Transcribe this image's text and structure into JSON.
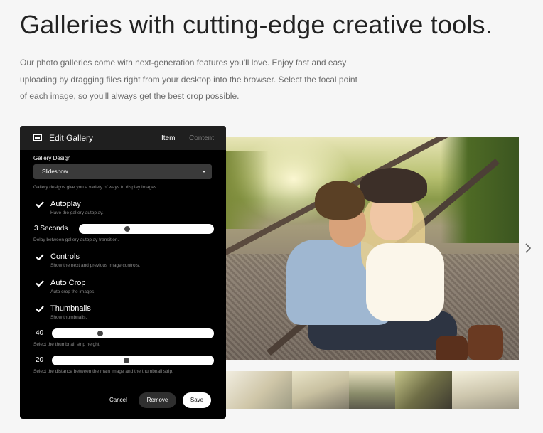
{
  "headline": "Galleries with cutting-edge creative tools.",
  "intro": "Our photo galleries come with next-generation features you'll love. Enjoy fast and easy uploading by dragging files right from your desktop into the browser. Select the focal point of each image, so you'll always get the best crop possible.",
  "panel": {
    "title": "Edit Gallery",
    "tabs": {
      "item": "Item",
      "content": "Content"
    },
    "design_label": "Gallery Design",
    "design_value": "Slideshow",
    "design_hint": "Gallery designs give you a variety of ways to display images.",
    "autoplay": {
      "label": "Autoplay",
      "desc": "Have the gallery autoplay.",
      "checked": true
    },
    "delay": {
      "value": "3 Seconds",
      "hint": "Delay between gallery autoplay transition.",
      "level": 0.35
    },
    "controls": {
      "label": "Controls",
      "desc": "Show the next and previous image controls.",
      "checked": true
    },
    "autocrop": {
      "label": "Auto Crop",
      "desc": "Auto crop the images.",
      "checked": true
    },
    "thumbnails": {
      "label": "Thumbnails",
      "desc": "Show thumbnails.",
      "checked": true
    },
    "strip_height": {
      "value": "40",
      "hint": "Select the thumbnail strip height.",
      "level": 0.29
    },
    "strip_distance": {
      "value": "20",
      "hint": "Select the distance between the main image and the thumbnail strip.",
      "level": 0.46
    },
    "buttons": {
      "cancel": "Cancel",
      "remove": "Remove",
      "save": "Save"
    }
  },
  "colors": {
    "page_bg": "#f6f6f6",
    "panel_bg": "#000000",
    "panel_header": "#1f1f1f",
    "muted_text": "#6b6b6b"
  },
  "icons": {
    "gallery": "gallery-icon",
    "next": "chevron-right-icon",
    "check": "check-icon"
  }
}
